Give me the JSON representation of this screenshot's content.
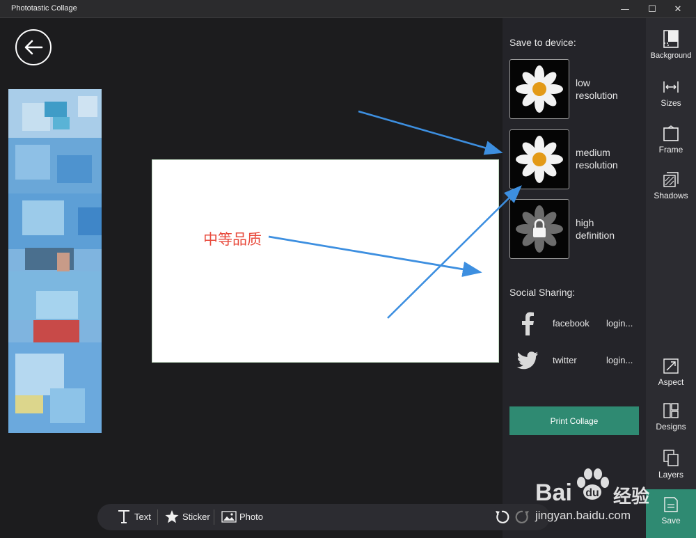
{
  "window": {
    "title": "Phototastic Collage",
    "minimize_glyph": "—",
    "maximize_glyph": "☐",
    "close_glyph": "✕"
  },
  "annotation": {
    "text": "中等品质",
    "color": "#e84a3c",
    "arrow_color": "#3d8fe0"
  },
  "save_panel": {
    "save_heading": "Save to device:",
    "resolutions": [
      {
        "line1": "low",
        "line2": "resolution",
        "locked": false
      },
      {
        "line1": "medium",
        "line2": "resolution",
        "locked": false
      },
      {
        "line1": "high",
        "line2": "definition",
        "locked": true
      }
    ],
    "social_heading": "Social Sharing:",
    "social": [
      {
        "name": "facebook",
        "login": "login...",
        "icon": "facebook-icon"
      },
      {
        "name": "twitter",
        "login": "login...",
        "icon": "twitter-icon"
      }
    ],
    "print_label": "Print Collage"
  },
  "tool_rail": {
    "background": "Background",
    "sizes": "Sizes",
    "frame": "Frame",
    "shadows": "Shadows",
    "aspect": "Aspect",
    "designs": "Designs",
    "layers": "Layers",
    "save": "Save"
  },
  "bottom_bar": {
    "text": "Text",
    "sticker": "Sticker",
    "photo": "Photo"
  },
  "watermark": {
    "brand": "Bai",
    "brand_cn": "经验",
    "url": "jingyan.baidu.com"
  },
  "colors": {
    "accent_green": "#2f8a72",
    "panel_bg": "#242429",
    "rail_bg": "#2c2c31"
  }
}
